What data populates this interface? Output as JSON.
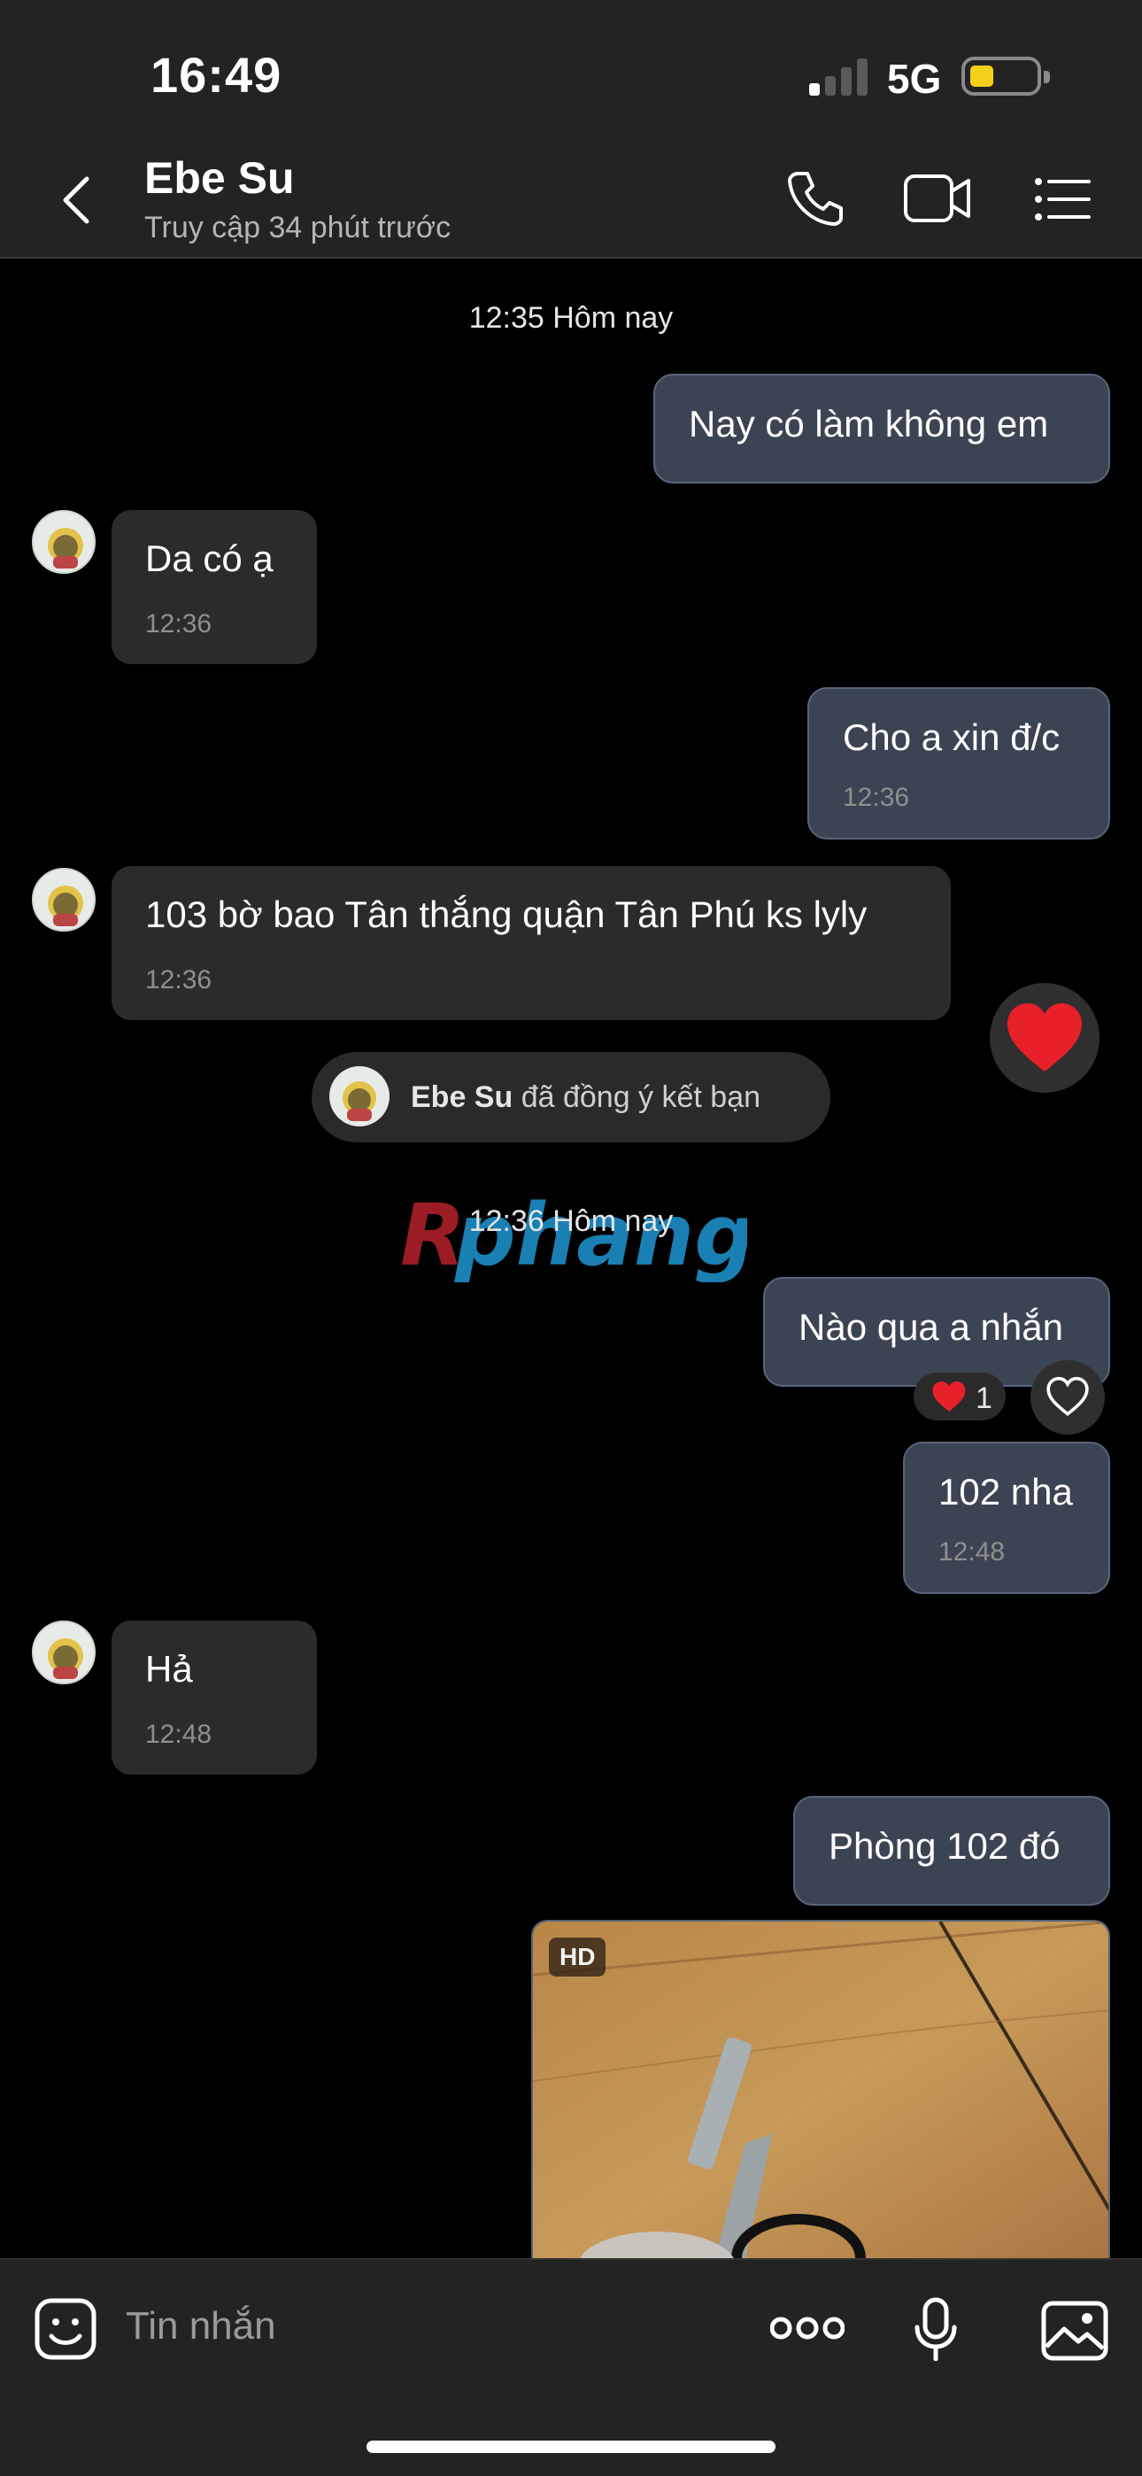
{
  "status": {
    "time": "16:49",
    "network": "5G"
  },
  "header": {
    "name": "Ebe Su",
    "subtitle": "Truy cập 34 phút trước"
  },
  "chat": {
    "date1": "12:35 Hôm nay",
    "date2": "12:36 Hôm nay",
    "messages": [
      {
        "text": "Nay có làm không em",
        "time": ""
      },
      {
        "text": "Da có ạ",
        "time": "12:36"
      },
      {
        "text": "Cho a xin đ/c",
        "time": "12:36"
      },
      {
        "text": "103 bờ bao Tân thắng quận Tân Phú ks lyly",
        "time": "12:36"
      },
      {
        "text": "Nào qua a nhắn",
        "time": ""
      },
      {
        "text": "102 nha",
        "time": "12:48"
      },
      {
        "text": "Hả",
        "time": "12:48"
      },
      {
        "text": "Phòng 102 đó",
        "time": ""
      }
    ],
    "system_name": "Ebe Su",
    "system_text": " đã đồng ý kết bạn",
    "reaction_count": "1",
    "photo_badge": "HD"
  },
  "watermark": "Rphang",
  "composer": {
    "placeholder": "Tin nhắn"
  },
  "colors": {
    "outgoing_bubble": "#3b4452",
    "incoming_bubble": "#2b2b2b",
    "heart": "#e8202a"
  }
}
